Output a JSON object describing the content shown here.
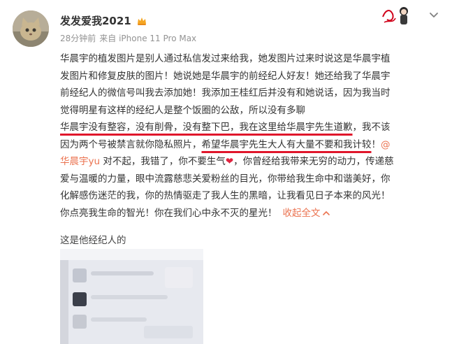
{
  "post": {
    "username": "发发爱我2021",
    "time": "28分钟前",
    "source": "来自 iPhone 11 Pro Max",
    "lines": [
      "华晨宇的植发图片是别人通过私信发过来给我，她发图片过来时说这是华晨宇植",
      "发图片和修复皮肤的图片！她说她是华晨宇的前经纪人好友！她还给我了华晨宇",
      "前经纪人的微信号叫我去添加她！我添加王桂红后并没有和她说话，因为我当时",
      "觉得明星有这样的经纪人是整个饭圈的公敌，所以没有多聊"
    ],
    "line5_underlined": "华晨宇没有整容，没有削骨，没有整下巴，我在这里给华晨宇先生道歉",
    "line5_rest": "，我不该",
    "line6_start": "因为两个号被禁言就你隐私照片，",
    "line6_underlined": "希望华晨宇先生大人有大量不要和我计较",
    "line6_end": "！",
    "line6_mention_start": "@",
    "line7_mention": "华晨宇yu",
    "line7_rest": " 对不起，我错了，你不要生气",
    "heart_glyph": "❤",
    "line7_tail": "，你曾经给我带来无穷的动力，传递慈",
    "lines_after": [
      "爱与温暖的力量，眼中流露慈悲关爱粉丝的目光，你带给我生命中和谐美好，你",
      "化解感伤迷茫的我，你的热情驱走了我人生的黑暗，让我看见日子本来的风光！"
    ],
    "last_line": "你点亮我生命的智光！你在我们心中永不灭的星光！",
    "fold_label": "收起全文",
    "fold_icon": "chevron-up-icon"
  },
  "image": {
    "caption": "这是他经纪人的"
  },
  "icons": {
    "vip": "crown-icon",
    "menu": "chevron-down-icon"
  },
  "colors": {
    "accent": "#eb7350",
    "underline": "#e0162b",
    "meta": "#939393"
  }
}
